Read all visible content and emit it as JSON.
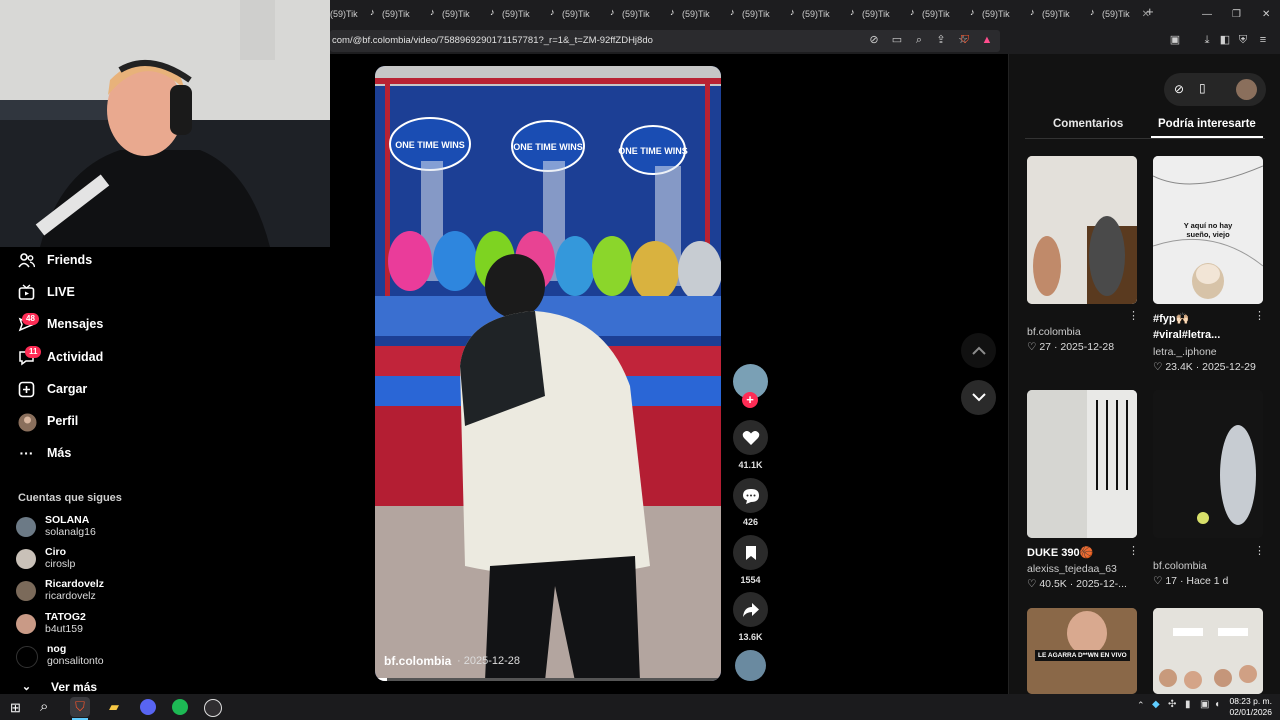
{
  "browser": {
    "tab_label": "(59)Tik",
    "tab_count": 14,
    "new_tab": "+",
    "url": "com/@bf.colombia/video/7588969290171157781?_r=1&_t=ZM-92ffZDHj8do",
    "window_controls": [
      "minimize-icon",
      "restore-icon",
      "close-icon"
    ]
  },
  "sidebar": {
    "items": [
      {
        "label": "Friends",
        "icon": "friends-icon"
      },
      {
        "label": "LIVE",
        "icon": "live-icon"
      },
      {
        "label": "Mensajes",
        "icon": "inbox-icon",
        "badge": "48"
      },
      {
        "label": "Actividad",
        "icon": "activity-icon",
        "badge": "11"
      },
      {
        "label": "Cargar",
        "icon": "upload-icon"
      },
      {
        "label": "Perfil",
        "icon": "avatar-icon"
      },
      {
        "label": "Más",
        "icon": "more-icon"
      }
    ],
    "following_title": "Cuentas que sigues",
    "following": [
      {
        "name": "SOLANA",
        "handle": "solanalg16"
      },
      {
        "name": "Ciro",
        "handle": "ciroslp"
      },
      {
        "name": "Ricardovelz",
        "handle": "ricardovelz"
      },
      {
        "name": "TATOG2",
        "handle": "b4ut159"
      },
      {
        "name": "nog",
        "handle": "gonsalitonto"
      }
    ],
    "see_more": "Ver más"
  },
  "video": {
    "author": "bf.colombia",
    "date": "· 2025-12-28",
    "overlay_sign": "ONE TIME WINS"
  },
  "actions": {
    "likes": "41.1K",
    "comments": "426",
    "saves": "1554",
    "shares": "13.6K"
  },
  "panel": {
    "tabs": [
      "Comentarios",
      "Podría interesarte"
    ],
    "active_tab": "Podría interesarte",
    "cards": [
      {
        "caption": "",
        "author": "bf.colombia",
        "likes": "27",
        "date": "2025-12-28"
      },
      {
        "caption": "#fyp🙌🏻 #viral#letra...",
        "author": "letra._.iphone",
        "likes": "23.4K",
        "date": "2025-12-29",
        "thumb_text": "Y aquí no hay sueño, viejo"
      },
      {
        "caption": "DUKE 390🏀",
        "author": "alexiss_tejedaa_63",
        "likes": "40.5K",
        "date": "2025-12-..."
      },
      {
        "caption": "",
        "author": "bf.colombia",
        "likes": "17",
        "date": "Hace 1 d"
      },
      {
        "caption": "",
        "author": "",
        "likes": "",
        "date": "",
        "thumb_text": "LE AGARRA D**WN EN VIVO"
      },
      {
        "caption": "",
        "author": "",
        "likes": "",
        "date": ""
      }
    ]
  },
  "taskbar": {
    "time": "08:23 p. m.",
    "date": "02/01/2026"
  },
  "colors": {
    "accent": "#fe2c55",
    "background": "#000000",
    "panel": "#121212"
  }
}
